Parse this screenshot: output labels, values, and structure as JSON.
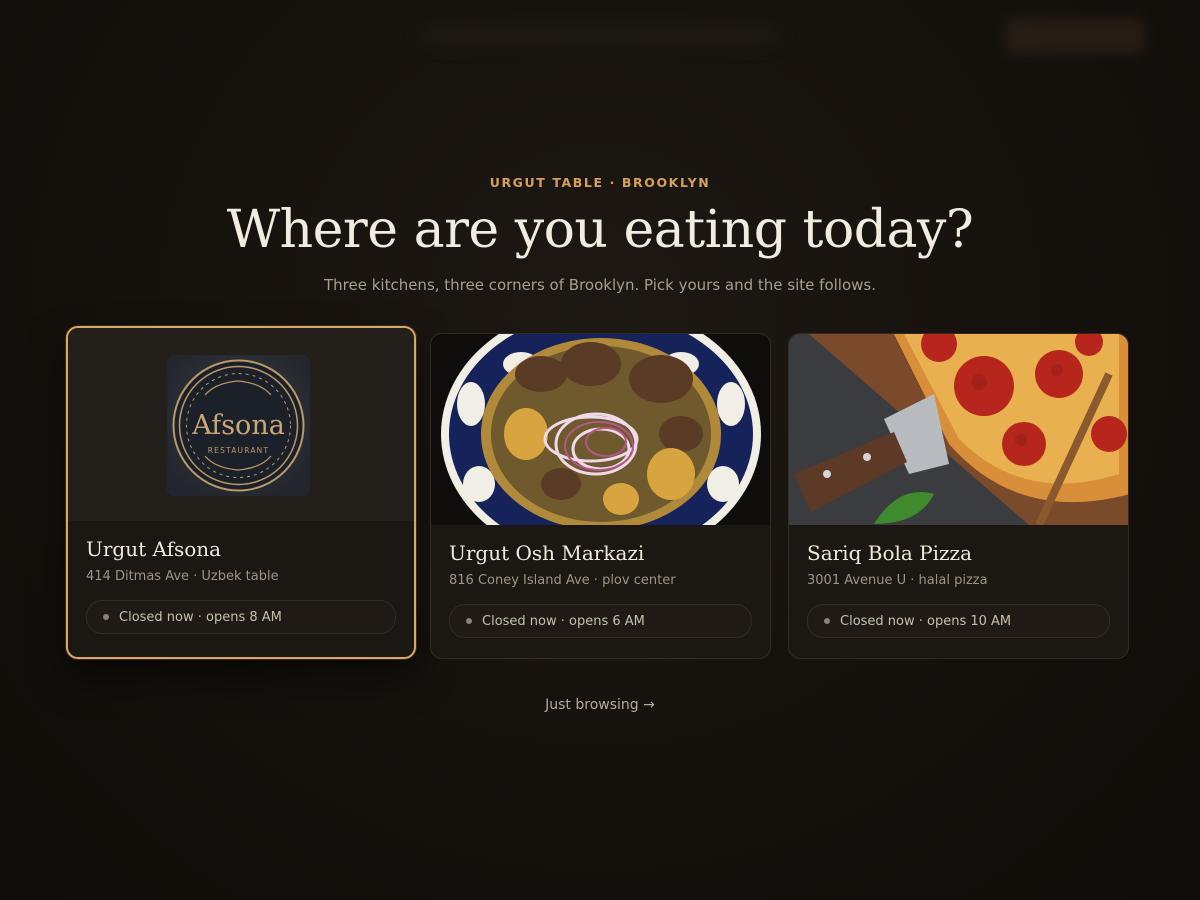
{
  "header": {
    "eyebrow": "URGUT TABLE · BROOKLYN",
    "title": "Where are you eating today?",
    "subtitle": "Three kitchens, three corners of Brooklyn. Pick yours and the site follows."
  },
  "locations": [
    {
      "name": "Urgut Afsona",
      "meta": "414 Ditmas Ave · Uzbek table",
      "status": "Closed now · opens 8 AM",
      "logo_text": "Afsona",
      "logo_subtext": "RESTAURANT",
      "selected": true
    },
    {
      "name": "Urgut Osh Markazi",
      "meta": "816 Coney Island Ave · plov center",
      "status": "Closed now · opens 6 AM",
      "photo": "plov-dish"
    },
    {
      "name": "Sariq Bola Pizza",
      "meta": "3001 Avenue U · halal pizza",
      "status": "Closed now · opens 10 AM",
      "photo": "pepperoni-pizza"
    }
  ],
  "browse_link": "Just browsing →",
  "colors": {
    "accent": "#d9a866",
    "eyebrow": "#d6a05a",
    "background": "#15110d",
    "card": "#1b1713",
    "status_dot": "#8a8176"
  }
}
